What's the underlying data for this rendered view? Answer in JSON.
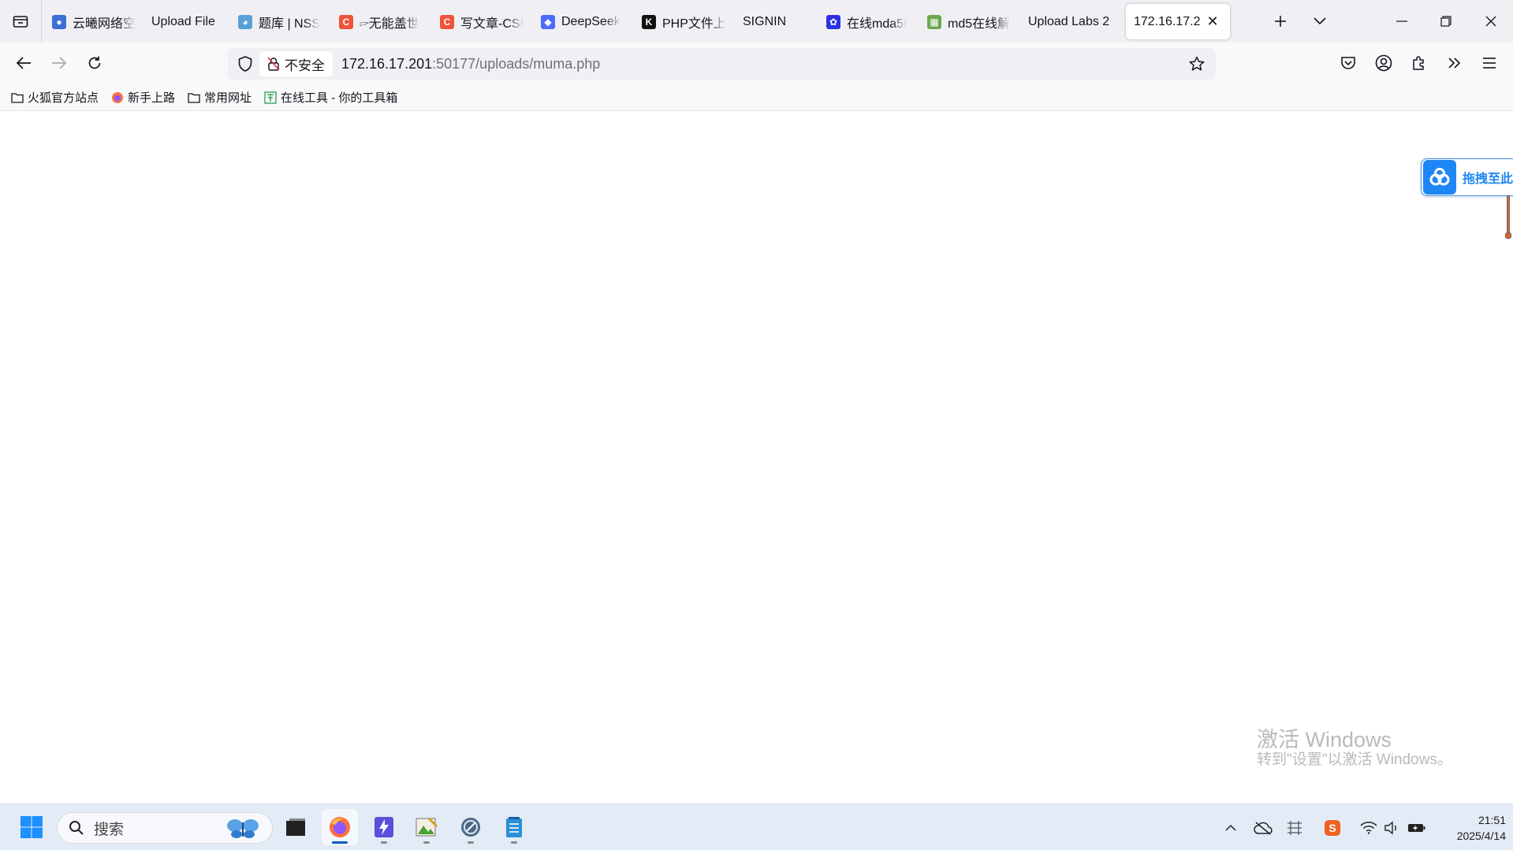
{
  "browser": {
    "tabs": [
      {
        "title": "云曦网络空",
        "favicon": "yunxi-icon",
        "color": "#3b6fd6",
        "width": 130
      },
      {
        "title": "Upload File",
        "favicon": "none",
        "color": "",
        "width": 130
      },
      {
        "title": "题库 | NSS",
        "favicon": "nss-icon",
        "color": "#5aa0d8",
        "width": 130
      },
      {
        "title": "🖙无能盖世",
        "favicon": "csdn-icon",
        "color": "#f0533a",
        "width": 130
      },
      {
        "title": "写文章-CSI",
        "favicon": "csdn-icon",
        "color": "#f0533a",
        "width": 130
      },
      {
        "title": "DeepSeek",
        "favicon": "deepseek-icon",
        "color": "#4d6bfe",
        "width": 130
      },
      {
        "title": "PHP文件上",
        "favicon": "k-icon",
        "color": "#111111",
        "width": 130
      },
      {
        "title": "SIGNIN",
        "favicon": "none",
        "color": "",
        "width": 130
      },
      {
        "title": "在线mda5i",
        "favicon": "baidu-icon",
        "color": "#2932e1",
        "width": 130
      },
      {
        "title": "md5在线解",
        "favicon": "md5-icon",
        "color": "#6aa84f",
        "width": 130
      },
      {
        "title": "Upload Labs 2",
        "favicon": "none",
        "color": "",
        "width": 130
      },
      {
        "title": "172.16.17.2",
        "favicon": "none",
        "color": "",
        "width": 125,
        "active": true
      }
    ],
    "url": {
      "security_label": "不安全",
      "host": "172.16.17.201",
      "rest": ":50177/uploads/muma.php"
    },
    "bookmarks": [
      {
        "label": "火狐官方站点",
        "icon": "folder-icon"
      },
      {
        "label": "新手上路",
        "icon": "firefox-icon"
      },
      {
        "label": "常用网址",
        "icon": "folder-icon"
      },
      {
        "label": "在线工具 - 你的工具箱",
        "icon": "tool-icon"
      }
    ]
  },
  "page": {
    "drag_widget_label": "拖拽至此",
    "watermark_title": "激活 Windows",
    "watermark_sub": "转到\"设置\"以激活 Windows。"
  },
  "taskbar": {
    "search_placeholder": "搜索",
    "time": "21:51",
    "date": "2025/4/14"
  },
  "colors": {
    "accent": "#1f87f5",
    "tab_strip": "#f0f0f4",
    "taskbar": "#e3ebf6"
  }
}
